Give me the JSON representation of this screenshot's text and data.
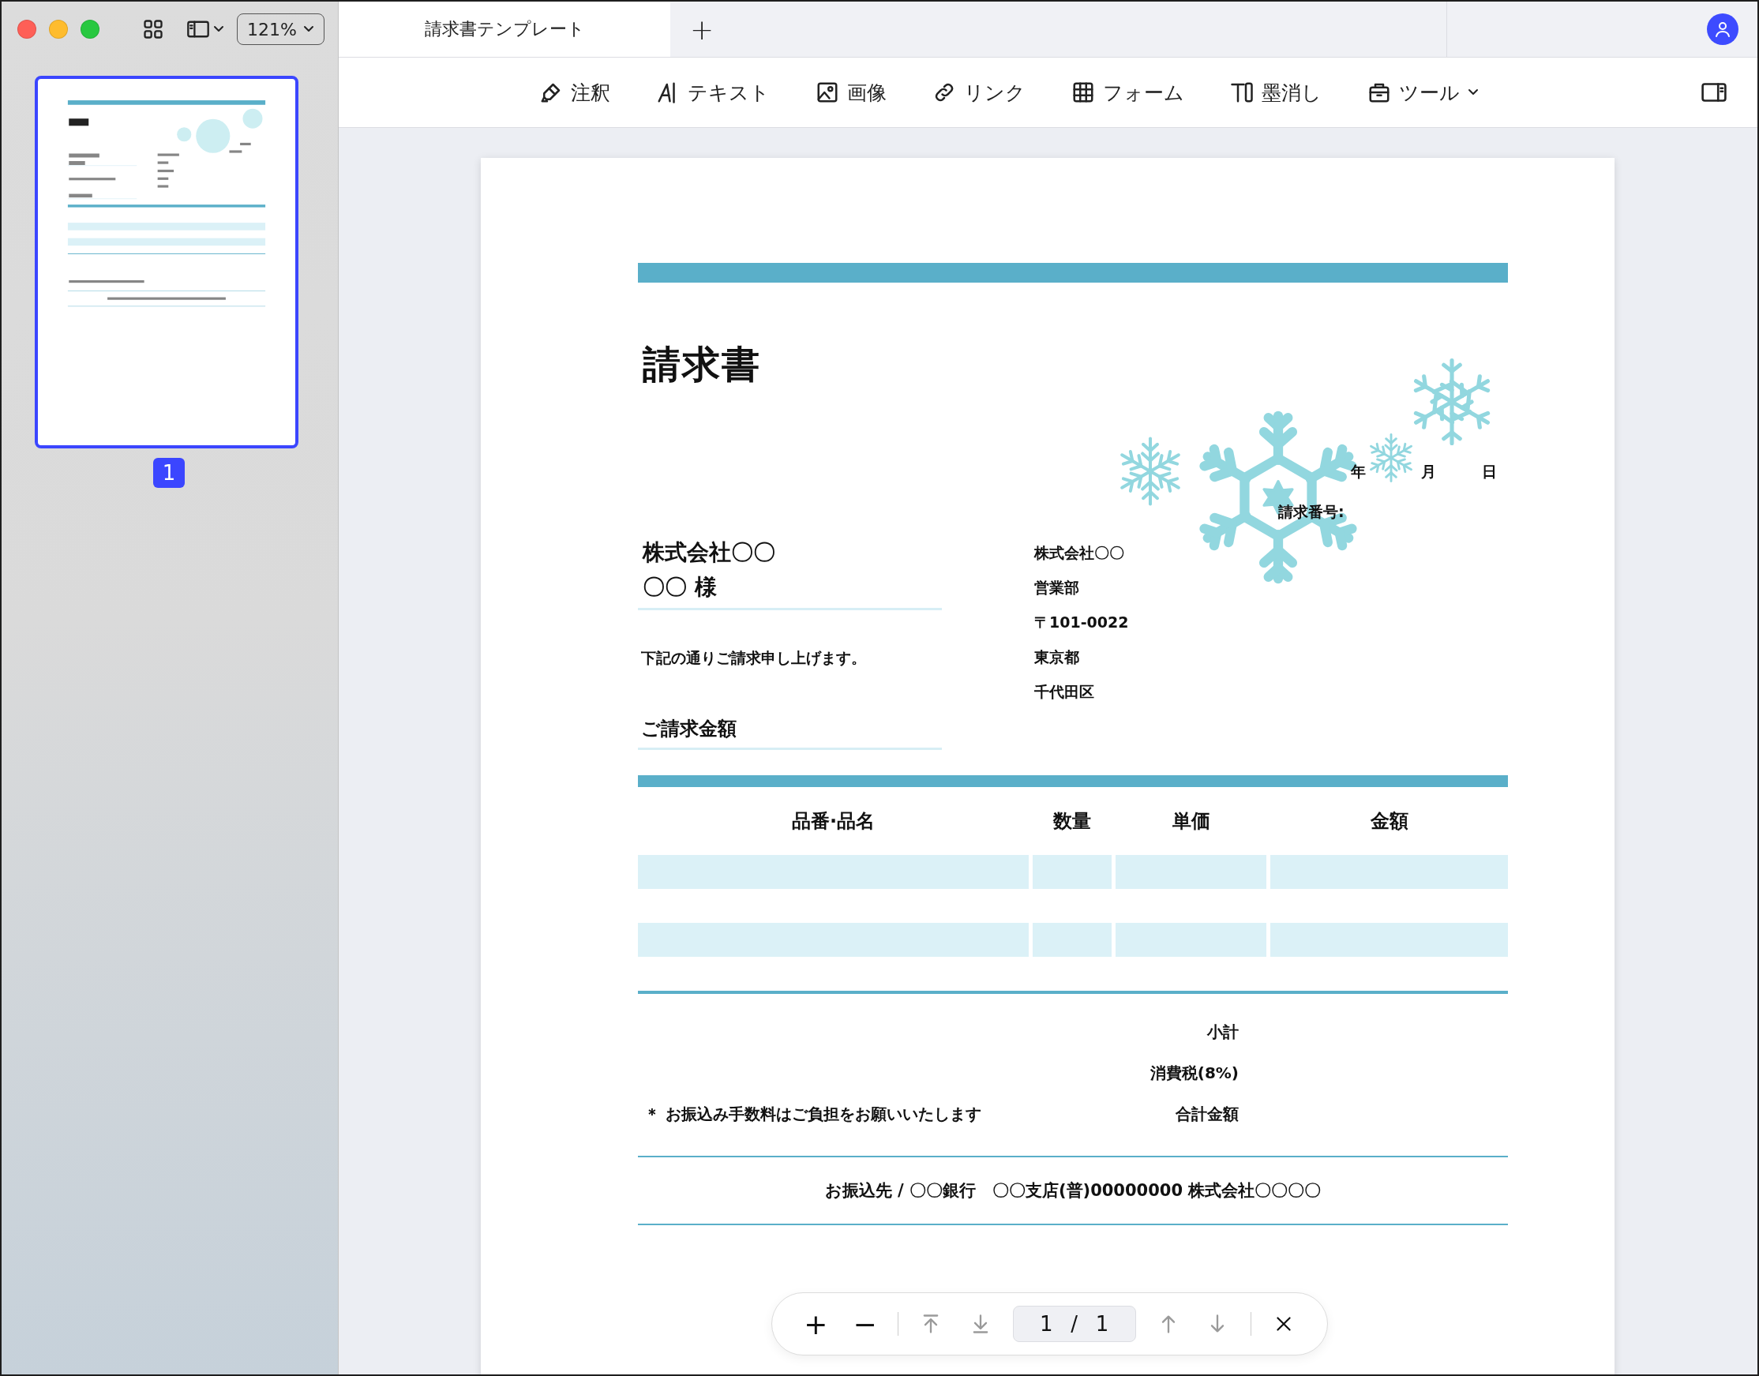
{
  "sidebar": {
    "zoom": "121%",
    "pages": [
      {
        "number": "1",
        "selected": true
      }
    ]
  },
  "tabs": [
    {
      "label": "請求書テンプレート",
      "selected": true
    }
  ],
  "new_tab": "+",
  "toolbar": [
    {
      "kind": "annotate",
      "label": "注釈",
      "dropdown": false
    },
    {
      "kind": "text",
      "label": "テキスト",
      "dropdown": false
    },
    {
      "kind": "image",
      "label": "画像",
      "dropdown": false
    },
    {
      "kind": "link",
      "label": "リンク",
      "dropdown": false
    },
    {
      "kind": "form",
      "label": "フォーム",
      "dropdown": false
    },
    {
      "kind": "redact",
      "label": "墨消し",
      "dropdown": false
    },
    {
      "kind": "tools",
      "label": "ツール",
      "dropdown": true
    }
  ],
  "document": {
    "title": "請求書",
    "date_labels": [
      "年",
      "月",
      "日"
    ],
    "invoice_number_label": "請求番号:",
    "recipient": {
      "company": "株式会社〇〇",
      "name": "〇〇 様"
    },
    "message": "下記の通りご請求申し上げます。",
    "amount_label": "ご請求金額",
    "sender": [
      "株式会社〇〇",
      "営業部",
      "〒101-0022",
      "東京都",
      "千代田区"
    ],
    "table": {
      "columns": [
        "品番·品名",
        "数量",
        "単価",
        "金額"
      ],
      "rows": [
        {
          "shaded": true
        },
        {
          "shaded": false
        },
        {
          "shaded": true
        }
      ]
    },
    "totals": [
      "小計",
      "消費税(8%)",
      "合計金額"
    ],
    "note": "＊ お振込み手数料はご負担をお願いいたします",
    "bank": "お振込先 / 〇〇銀行　〇〇支店(普)00000000 株式会社〇〇〇〇"
  },
  "pager": {
    "zoom_buttons": [
      "+",
      "−"
    ],
    "jump_buttons": [
      {
        "kind": "top",
        "disabled": true
      },
      {
        "kind": "bottom",
        "disabled": true
      }
    ],
    "page": "1",
    "separator": "/",
    "total": "1",
    "step_buttons": [
      {
        "kind": "up",
        "disabled": true
      },
      {
        "kind": "down",
        "disabled": true
      }
    ]
  }
}
